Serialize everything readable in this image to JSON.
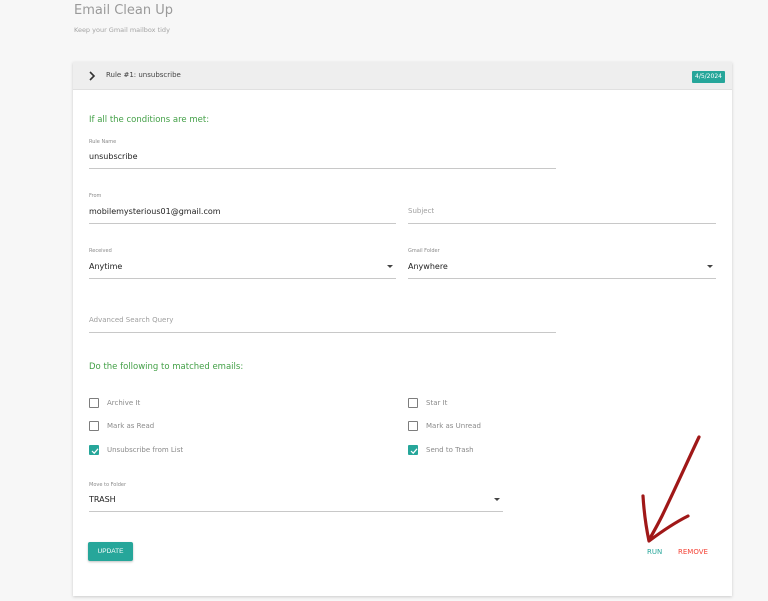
{
  "header": {
    "title": "Email Clean Up",
    "subtitle": "Keep your Gmail mailbox tidy"
  },
  "rule": {
    "title": "Rule #1: unsubscribe",
    "date_badge": "4/5/2024",
    "conditions_heading": "If all the conditions are met:",
    "actions_heading": "Do the following to matched emails:",
    "rule_name": {
      "label": "Rule Name",
      "value": "unsubscribe"
    },
    "from": {
      "label": "From",
      "value": "mobilemysterious01@gmail.com"
    },
    "subject": {
      "placeholder": "Subject"
    },
    "received": {
      "label": "Received",
      "value": "Anytime"
    },
    "gmail_folder": {
      "label": "Gmail Folder",
      "value": "Anywhere"
    },
    "advanced_query": {
      "placeholder": "Advanced Search Query"
    },
    "actions": {
      "archive": {
        "label": "Archive It",
        "checked": false
      },
      "star": {
        "label": "Star It",
        "checked": false
      },
      "mark_read": {
        "label": "Mark as Read",
        "checked": false
      },
      "mark_unread": {
        "label": "Mark as Unread",
        "checked": false
      },
      "unsubscribe": {
        "label": "Unsubscribe from List",
        "checked": true
      },
      "send_trash": {
        "label": "Send to Trash",
        "checked": true
      }
    },
    "move_to_folder": {
      "label": "Move to Folder",
      "value": "TRASH"
    },
    "buttons": {
      "update": "UPDATE",
      "run": "RUN",
      "remove": "REMOVE"
    }
  },
  "colors": {
    "accent": "#26a69a",
    "section_heading": "#43a047",
    "remove": "#f44336",
    "annotation_arrow": "#a01818"
  },
  "icons": {
    "expand": "chevron-right-icon",
    "dropdown": "caret-down-icon",
    "checked": "checkmark-icon",
    "annotation": "hand-drawn-arrow"
  }
}
